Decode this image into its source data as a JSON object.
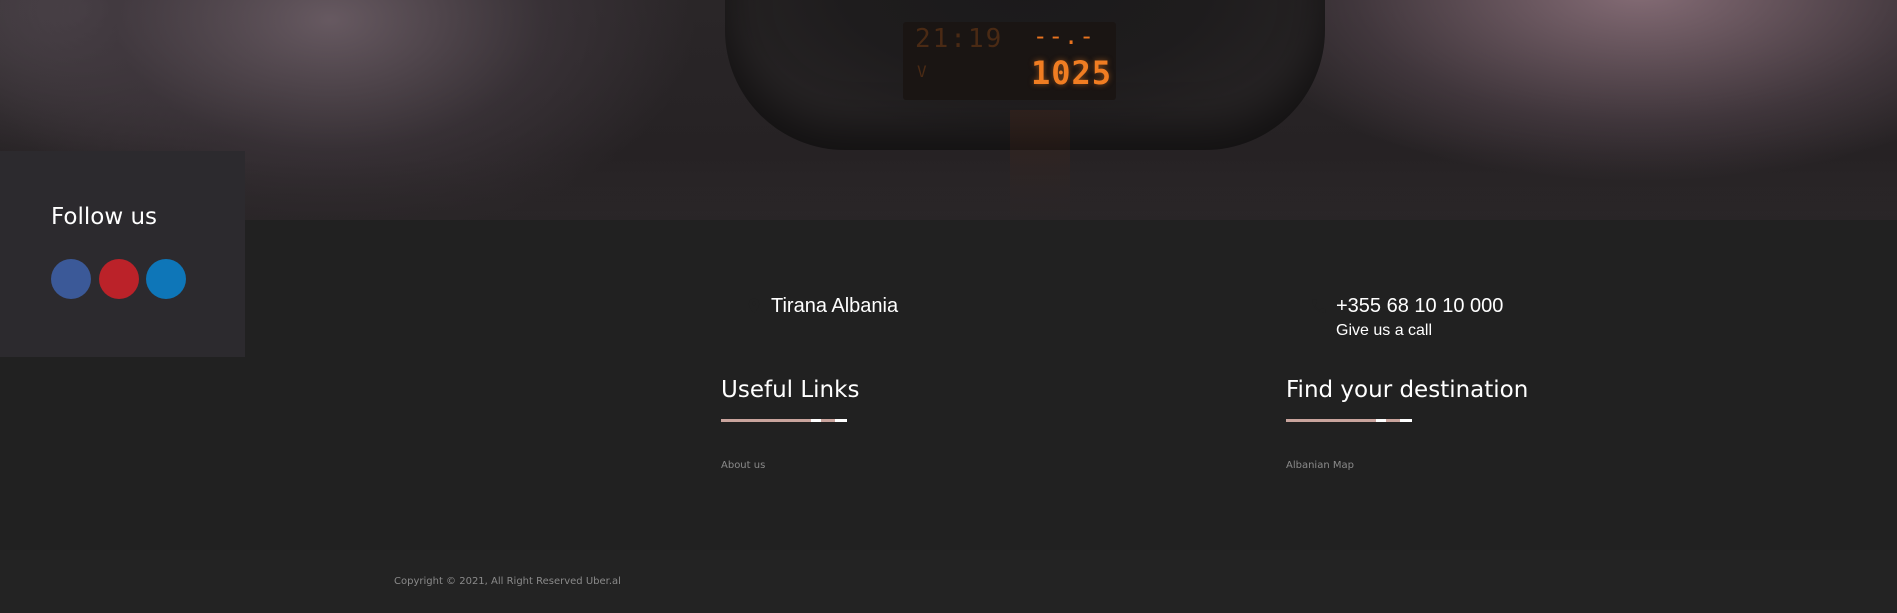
{
  "hero": {
    "clock_time": "21:19",
    "clock_indicator": "V",
    "radio_top": "--.-",
    "radio_frequency": "1025"
  },
  "follow": {
    "title": "Follow us",
    "social": [
      {
        "name": "facebook",
        "icon": "facebook-icon",
        "color": "#3b5998"
      },
      {
        "name": "youtube",
        "icon": "youtube-icon",
        "color": "#bb2229"
      },
      {
        "name": "linkedin",
        "icon": "linkedin-icon",
        "color": "#0e76b8"
      }
    ]
  },
  "contact": {
    "address": "Tirana Albania",
    "address_icon": "map-marker-icon",
    "phone": "+355 68 10 10 000",
    "phone_sub": "Give us a call",
    "phone_icon": "phone-icon"
  },
  "columns": {
    "useful_links": {
      "title": "Useful Links",
      "links": [
        "About us"
      ]
    },
    "destination": {
      "title": "Find your destination",
      "links": [
        "Albanian Map"
      ]
    }
  },
  "footer": {
    "copyright": "Copyright © 2021, All Right Reserved Uber.al"
  },
  "colors": {
    "background": "#212121",
    "follow_box": "#2c2a2e",
    "underline_accent": "#c9a49d",
    "link_text": "#8a8a8a"
  }
}
